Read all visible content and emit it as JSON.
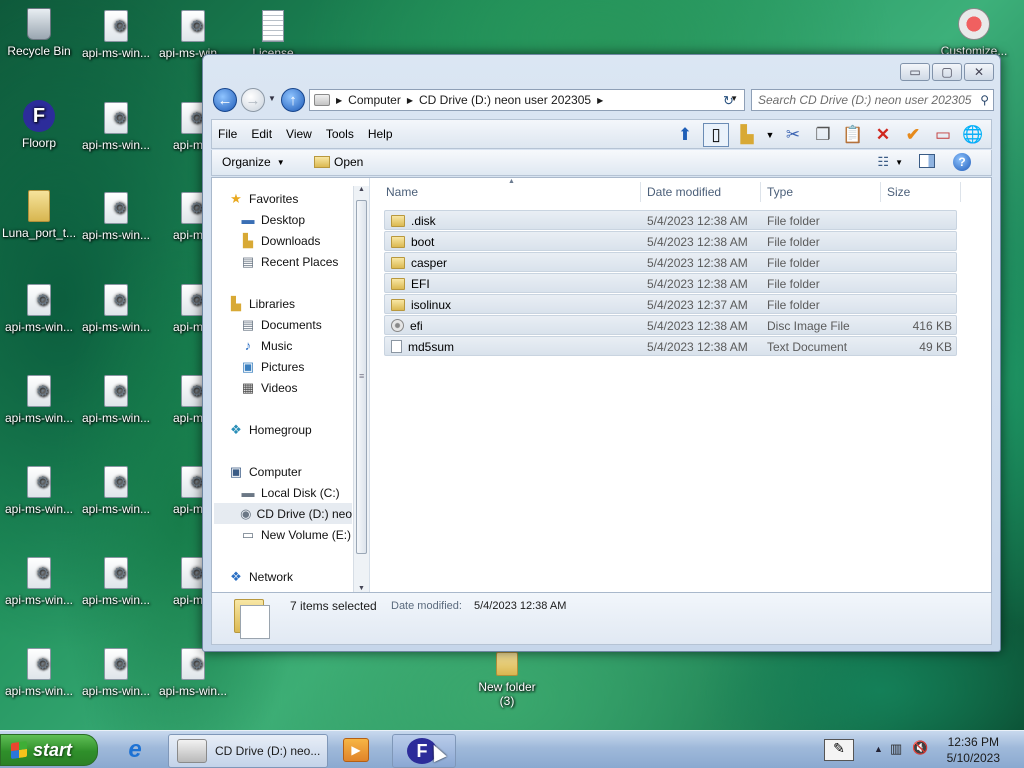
{
  "desktop": {
    "icons": [
      {
        "label": "Recycle Bin"
      },
      {
        "label": "api-ms-win..."
      },
      {
        "label": "api-ms-win..."
      },
      {
        "label": "License"
      },
      {
        "label": "Customize..."
      },
      {
        "label": "Floorp"
      },
      {
        "label": "api-ms-win..."
      },
      {
        "label": "api-ms-"
      },
      {
        "label": "Luna_port_t..."
      },
      {
        "label": "api-ms-win..."
      },
      {
        "label": "api-ms-"
      },
      {
        "label": "api-ms-win..."
      },
      {
        "label": "api-ms-win..."
      },
      {
        "label": "api-ms-"
      },
      {
        "label": "api-ms-win..."
      },
      {
        "label": "api-ms-win..."
      },
      {
        "label": "api-ms-"
      },
      {
        "label": "api-ms-win..."
      },
      {
        "label": "api-ms-win..."
      },
      {
        "label": "api-ms-"
      },
      {
        "label": "api-ms-win..."
      },
      {
        "label": "api-ms-win..."
      },
      {
        "label": "api-ms-"
      },
      {
        "label": "api-ms-win..."
      },
      {
        "label": "api-ms-win..."
      },
      {
        "label": "api-ms-win..."
      },
      {
        "label": "New folder\n(3)"
      }
    ]
  },
  "window": {
    "title_buttons": {
      "minimize": "▭",
      "maximize": "▢",
      "close": "✕"
    },
    "address": {
      "segments": [
        "Computer",
        "CD Drive (D:) neon user 202305"
      ],
      "separator": "▶",
      "dropdown": "▼",
      "refresh": "↻"
    },
    "search": {
      "placeholder": "Search CD Drive (D:) neon user 202305"
    },
    "menu": [
      "File",
      "Edit",
      "View",
      "Tools",
      "Help"
    ],
    "command_bar": {
      "organize": "Organize",
      "open": "Open"
    },
    "nav": {
      "favorites": "Favorites",
      "desktop": "Desktop",
      "downloads": "Downloads",
      "recent": "Recent Places",
      "libraries": "Libraries",
      "documents": "Documents",
      "music": "Music",
      "pictures": "Pictures",
      "videos": "Videos",
      "homegroup": "Homegroup",
      "computer": "Computer",
      "local_disk": "Local Disk (C:)",
      "cd_drive": "CD Drive (D:) neo",
      "new_volume": "New Volume (E:)",
      "network": "Network"
    },
    "columns": {
      "name": "Name",
      "date": "Date modified",
      "type": "Type",
      "size": "Size"
    },
    "files": [
      {
        "name": ".disk",
        "date": "5/4/2023 12:38 AM",
        "type": "File folder",
        "size": "",
        "icon": "folder"
      },
      {
        "name": "boot",
        "date": "5/4/2023 12:38 AM",
        "type": "File folder",
        "size": "",
        "icon": "folder"
      },
      {
        "name": "casper",
        "date": "5/4/2023 12:38 AM",
        "type": "File folder",
        "size": "",
        "icon": "folder"
      },
      {
        "name": "EFI",
        "date": "5/4/2023 12:38 AM",
        "type": "File folder",
        "size": "",
        "icon": "folder"
      },
      {
        "name": "isolinux",
        "date": "5/4/2023 12:37 AM",
        "type": "File folder",
        "size": "",
        "icon": "folder"
      },
      {
        "name": "efi",
        "date": "5/4/2023 12:38 AM",
        "type": "Disc Image File",
        "size": "416 KB",
        "icon": "disc"
      },
      {
        "name": "md5sum",
        "date": "5/4/2023 12:38 AM",
        "type": "Text Document",
        "size": "49 KB",
        "icon": "doc"
      }
    ],
    "details": {
      "selected": "7 items selected",
      "date_label": "Date modified:",
      "date_value": "5/4/2023 12:38 AM"
    }
  },
  "taskbar": {
    "start": "start",
    "items": [
      {
        "label": "CD Drive (D:) neo..."
      }
    ],
    "clock_time": "12:36 PM",
    "clock_date": "5/10/2023"
  }
}
